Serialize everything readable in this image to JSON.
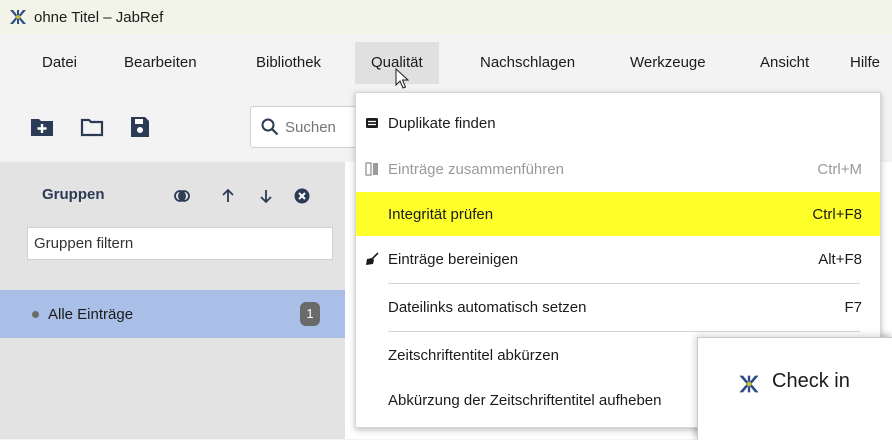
{
  "window": {
    "title": "ohne Titel – JabRef"
  },
  "menubar": {
    "items": [
      "Datei",
      "Bearbeiten",
      "Bibliothek",
      "Qualität",
      "Nachschlagen",
      "Werkzeuge",
      "Ansicht",
      "Hilfe"
    ],
    "active": "Qualität"
  },
  "toolbar": {
    "icons": [
      "new-library-icon",
      "open-folder-icon",
      "save-icon"
    ],
    "search_placeholder": "Suchen"
  },
  "groups": {
    "title": "Gruppen",
    "icons": [
      "intersection-icon",
      "arrow-up-icon",
      "arrow-down-icon",
      "close-circle-icon"
    ],
    "filter_placeholder": "Gruppen filtern",
    "items": [
      {
        "label": "Alle Einträge",
        "count": "1"
      }
    ]
  },
  "quality_menu": {
    "items": [
      {
        "label": "Duplikate finden",
        "shortcut": "",
        "icon": "duplicates-icon",
        "state": "normal"
      },
      {
        "label": "Einträge zusammenführen",
        "shortcut": "Ctrl+M",
        "icon": "merge-icon",
        "state": "disabled"
      },
      {
        "label": "Integrität prüfen",
        "shortcut": "Ctrl+F8",
        "icon": "",
        "state": "highlighted"
      },
      {
        "label": "Einträge bereinigen",
        "shortcut": "Alt+F8",
        "icon": "broom-icon",
        "state": "normal"
      },
      {
        "label": "Dateilinks automatisch setzen",
        "shortcut": "F7",
        "icon": "",
        "state": "normal"
      },
      {
        "label": "Zeitschriftentitel abkürzen",
        "shortcut": "",
        "icon": "",
        "state": "normal"
      },
      {
        "label": "Abkürzung der Zeitschriftentitel aufheben",
        "shortcut": "",
        "icon": "",
        "state": "normal"
      }
    ]
  },
  "dialog": {
    "title": "Check in"
  },
  "colors": {
    "highlight": "#ffff2a",
    "selected_group": "#a9bfe8",
    "titlebar": "#f1f4e7",
    "accent": "#2b3a55"
  }
}
